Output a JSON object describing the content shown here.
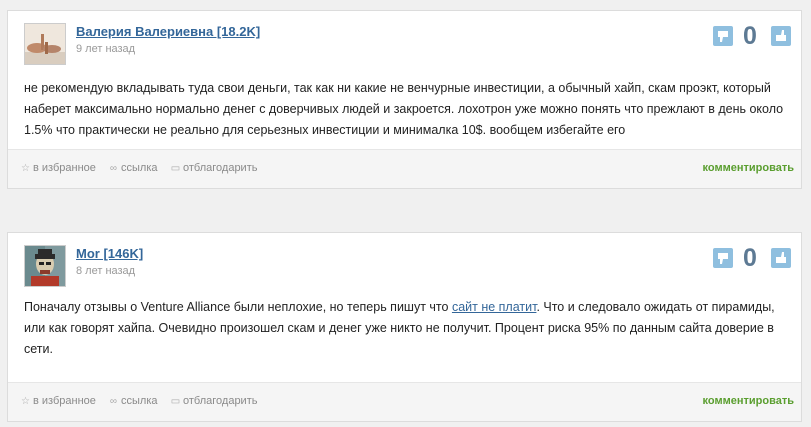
{
  "comments": [
    {
      "author": "Валерия Валериевна [18.2K]",
      "date": "9 лет назад",
      "score": "0",
      "text": "не рекомендую вкладывать туда свои деньги, так как ни какие не венчурные инвестиции, а обычный хайп, скам проэкт, который наберет максимально нормально денег с доверчивых людей и закроется. лохотрон уже можно понять что прежлают в день около 1.5% что практически не реально для серьезных инвестиции и минималка 10$. вообщем избегайте его"
    },
    {
      "author": "Mor [146K]",
      "date": "8 лет назад",
      "score": "0",
      "text_before": "Поначалу отзывы о Venture Alliance были неплохие, но теперь пишут что ",
      "link_text": "сайт не платит",
      "text_after": ". Что и следовало ожидать от пирамиды, или как говорят хайпа. Очевидно произошел скам и денег уже никто не получит. Процент риска 95% по данным сайта доверие в сети."
    }
  ],
  "actions": {
    "favorite": "в избранное",
    "link": "ссылка",
    "thank": "отблагодарить",
    "comment": "комментировать"
  },
  "colors": {
    "author_link": "#336699",
    "comment_action": "#5a9e2f",
    "vote_button": "#8fbfdf",
    "score": "#5d7a94"
  },
  "icons": [
    "thumbs-down-icon",
    "thumbs-up-icon",
    "star-icon",
    "chain-link-icon",
    "gift-icon"
  ]
}
